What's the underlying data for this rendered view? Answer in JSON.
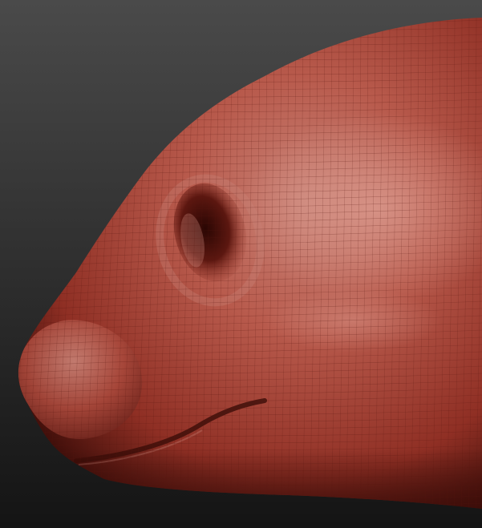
{
  "viewport": {
    "background_top": "#4a4a4a",
    "background_bottom": "#141414",
    "material_base": "#b3473a",
    "material_shadow": "#3a0c08",
    "material_highlight": "#c98377",
    "wireframe_color": "#5a1812"
  },
  "model": {
    "subject": "sculpted-animal-snout",
    "shading": "matcap-red-wax",
    "wireframe": true
  }
}
